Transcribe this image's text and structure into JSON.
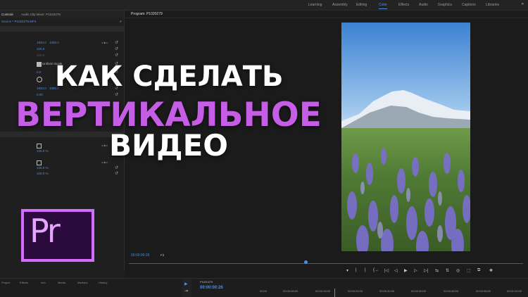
{
  "topbar": {
    "workspaces": [
      "Learning",
      "Assembly",
      "Editing",
      "Color",
      "Effects",
      "Audio",
      "Graphics",
      "Captions",
      "Libraries"
    ],
    "active_workspace": "Color",
    "more_label": "»"
  },
  "left_panel": {
    "tabs": [
      "Controls",
      "Audio Clip Mixer: P1020279"
    ],
    "source": "Source * P1020279.MP4",
    "source_close": "×",
    "values": {
      "position_x": "1920.0",
      "position_y": "1080.0",
      "scale": "100.0",
      "uniform_scale_label": "Uniform Scale",
      "uniform_scale_value": "100.0",
      "rotation": "0.0",
      "anchor_x": "1920.0",
      "anchor_y": "1080.0",
      "flicker": "0.00",
      "opacity_1": "100.0 %",
      "opacity_2": "100.0 %",
      "opacity_3": "100.0 %"
    },
    "reset_icon": "↺"
  },
  "program": {
    "title": "Program: P1020279",
    "timecode": "00:00:00:26",
    "fit": "Fit"
  },
  "controls": [
    "▾",
    "|",
    "|",
    "{→",
    "|◁",
    "◁",
    "▶",
    "▷",
    "▷|",
    "⇆",
    "⇅",
    "◎",
    "⬚",
    "⧉",
    "✚"
  ],
  "bottom": {
    "project_tabs": [
      "Project",
      "Effects",
      "Info",
      "Media",
      "Markers",
      "History"
    ],
    "timeline_title": "P1020279",
    "timeline_tc": "00:00:00:26",
    "ticks": [
      "00:00",
      "00:00:08:00",
      "00:00:16:00",
      "00:00:24:00",
      "00:00:32:00",
      "00:00:40:00",
      "00:00:48:00",
      "00:00:56:00",
      "00:01:04:00"
    ]
  },
  "headline": {
    "line1": "КАК СДЕЛАТЬ",
    "line2": "ВЕРТИКАЛЬНОЕ",
    "line3": "ВИДЕО"
  },
  "logo": {
    "text": "Pr",
    "border_color": "#d66cff",
    "fill_color": "#2b0a3d"
  },
  "colors": {
    "accent": "#4a8fe8",
    "headline_purple": "#c65de6"
  }
}
